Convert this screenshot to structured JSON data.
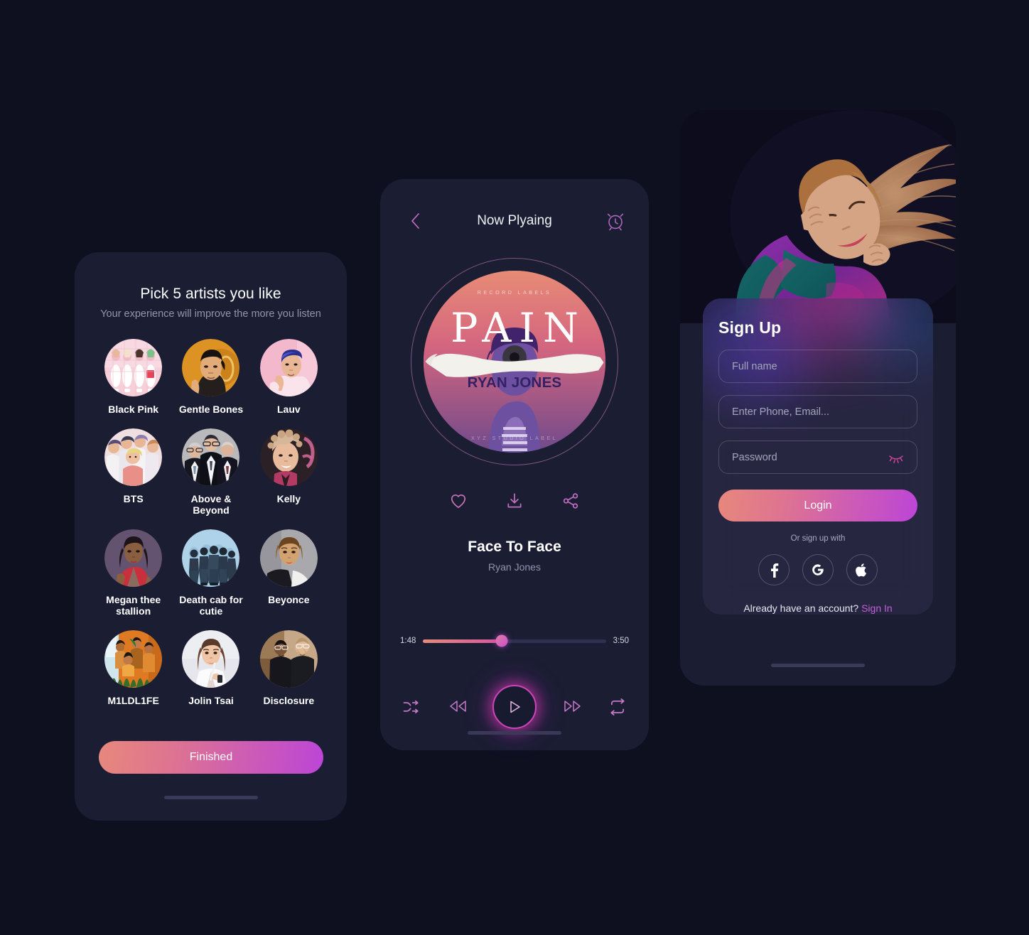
{
  "theme": {
    "background": "#0e1020",
    "card": "#1b1d33",
    "accent_pink": "#d7559e",
    "accent_purple": "#bc45d6",
    "accent_coral": "#e8887c",
    "muted_text": "#9195ad"
  },
  "artist_picker": {
    "title": "Pick 5 artists you like",
    "subtitle": "Your experience will improve the more you listen",
    "finished_label": "Finished",
    "artists": [
      {
        "name": "Black Pink",
        "avatar": "blackpink-avatar"
      },
      {
        "name": "Gentle Bones",
        "avatar": "gentlebones-avatar"
      },
      {
        "name": "Lauv",
        "avatar": "lauv-avatar"
      },
      {
        "name": "BTS",
        "avatar": "bts-avatar"
      },
      {
        "name": "Above & Beyond",
        "avatar": "aboveandbeyond-avatar"
      },
      {
        "name": "Kelly",
        "avatar": "kelly-avatar"
      },
      {
        "name": "Megan thee stallion",
        "avatar": "megantheestallion-avatar"
      },
      {
        "name": "Death cab for cutie",
        "avatar": "deathcabforcutie-avatar"
      },
      {
        "name": "Beyonce",
        "avatar": "beyonce-avatar"
      },
      {
        "name": "M1LDL1FE",
        "avatar": "m1ldl1fe-avatar"
      },
      {
        "name": "Jolin Tsai",
        "avatar": "jolintsai-avatar"
      },
      {
        "name": "Disclosure",
        "avatar": "disclosure-avatar"
      }
    ]
  },
  "player": {
    "header_title": "Now Plyaing",
    "back_icon": "chevron-left-icon",
    "alarm_icon": "alarm-clock-icon",
    "album_art": {
      "label_top": "RECORD LABELS",
      "main_text": "PAIN",
      "artist_banner": "RYAN JONES",
      "label_bottom": "XYZ STUDIO LABEL"
    },
    "actions": [
      {
        "icon": "heart-icon",
        "name": "like-button"
      },
      {
        "icon": "download-icon",
        "name": "download-button"
      },
      {
        "icon": "share-icon",
        "name": "share-button"
      }
    ],
    "song_title": "Face To Face",
    "song_artist": "Ryan Jones",
    "progress": {
      "current_time": "1:48",
      "total_time": "3:50",
      "percent": 43
    },
    "controls": [
      {
        "icon": "shuffle-icon",
        "name": "shuffle-button"
      },
      {
        "icon": "rewind-icon",
        "name": "previous-button"
      },
      {
        "icon": "play-icon",
        "name": "play-button"
      },
      {
        "icon": "forward-icon",
        "name": "next-button"
      },
      {
        "icon": "repeat-icon",
        "name": "repeat-button"
      }
    ]
  },
  "signup": {
    "hero_image": "woman-listening-music-photo",
    "title": "Sign Up",
    "fields": [
      {
        "name": "full-name-field",
        "placeholder": "Full name",
        "value": ""
      },
      {
        "name": "phone-email-field",
        "placeholder": "Enter Phone, Email...",
        "value": ""
      },
      {
        "name": "password-field",
        "placeholder": "Password",
        "value": ""
      }
    ],
    "password_toggle_icon": "eye-off-icon",
    "login_label": "Login",
    "or_text": "Or sign up with",
    "socials": [
      {
        "name": "facebook-button",
        "icon": "facebook-icon",
        "glyph": "f"
      },
      {
        "name": "google-button",
        "icon": "google-icon",
        "glyph": "G"
      },
      {
        "name": "apple-button",
        "icon": "apple-icon",
        "glyph": ""
      }
    ],
    "footer_text": "Already have an account?",
    "footer_link": "Sign In"
  }
}
